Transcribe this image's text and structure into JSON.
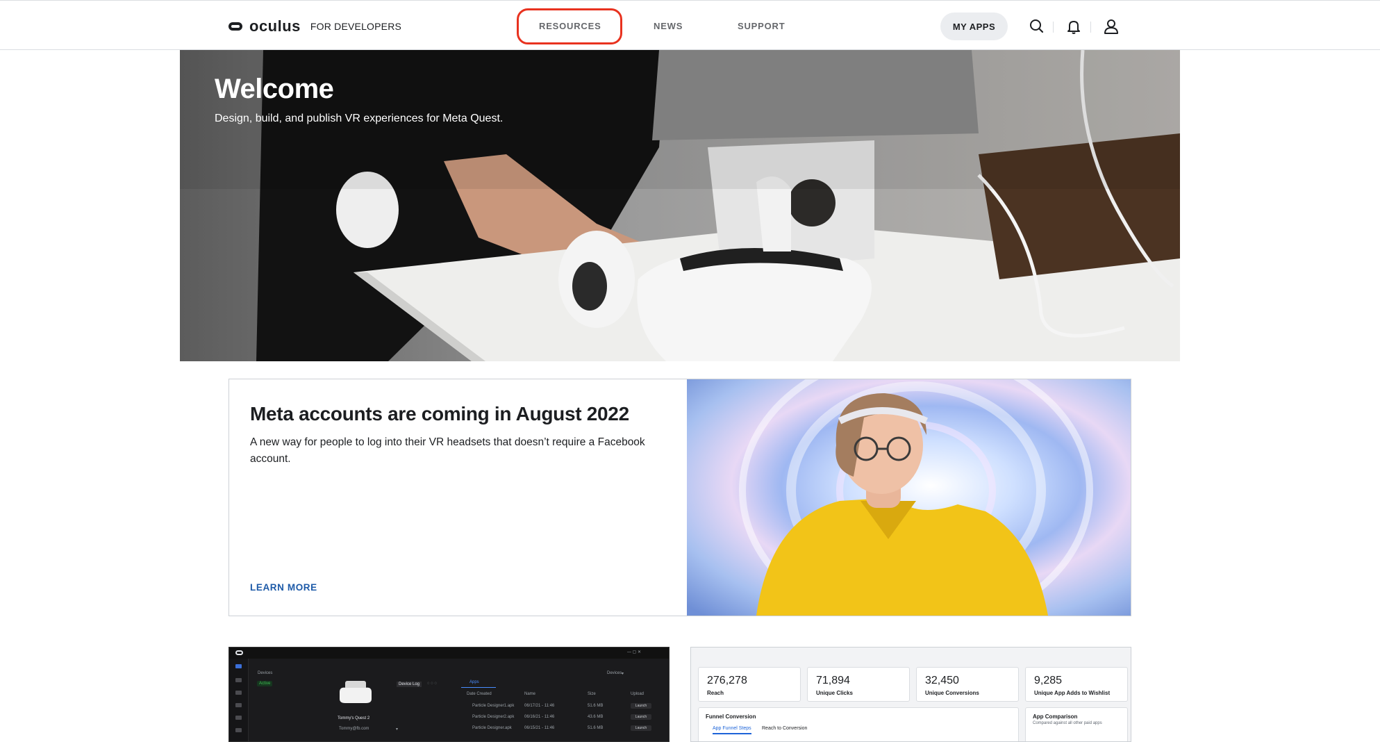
{
  "nav": {
    "brand_name": "oculus",
    "brand_sub": "FOR DEVELOPERS",
    "links": {
      "resources": "RESOURCES",
      "news": "NEWS",
      "support": "SUPPORT"
    },
    "my_apps": "MY APPS",
    "highlight_color": "#e8321f"
  },
  "hero": {
    "title": "Welcome",
    "subtitle": "Design, build, and publish VR experiences for Meta Quest."
  },
  "feature": {
    "title": "Meta accounts are coming in August 2022",
    "description": "A new way for people to log into their VR headsets that doesn’t require a Facebook account.",
    "cta": "LEARN MORE",
    "cta_color": "#1d5aa8"
  },
  "device_manager": {
    "devices_label": "Devices",
    "status": "Active",
    "device_name": "Tommy's Quest 2",
    "account": "Tommy@fb.com",
    "device_log": "Device Log",
    "apps_tab": "Apps",
    "date_created": "Date Created",
    "name_col": "Name",
    "size_col": "Size",
    "upload": "Upload",
    "devices_dropdown": "Devices",
    "rows": [
      {
        "name": "Particle Designer1.apk",
        "date": "06/17/21 - 11:46",
        "size": "51.6 MB",
        "action": "Launch"
      },
      {
        "name": "Particle Designer2.apk",
        "date": "06/16/21 - 11:46",
        "size": "43.6 MB",
        "action": "Launch"
      },
      {
        "name": "Particle Designer.apk",
        "date": "06/15/21 - 11:46",
        "size": "51.6 MB",
        "action": "Launch"
      }
    ]
  },
  "analytics": {
    "stats": [
      {
        "value": "276,278",
        "label": "Reach"
      },
      {
        "value": "71,894",
        "label": "Unique Clicks"
      },
      {
        "value": "32,450",
        "label": "Unique Conversions"
      },
      {
        "value": "9,285",
        "label": "Unique App Adds to Wishlist"
      }
    ],
    "funnel": {
      "title": "Funnel Conversion",
      "tabs": [
        "App Funnel Steps",
        "Reach to Conversion"
      ]
    },
    "comparison": {
      "title": "App Comparison",
      "subtitle": "Compared against all other paid apps"
    }
  }
}
